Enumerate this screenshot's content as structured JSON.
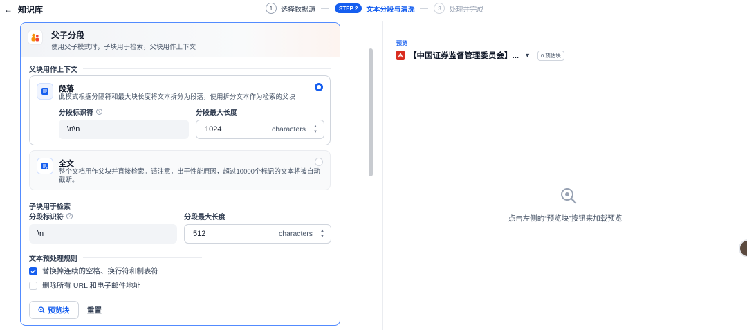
{
  "topbar": {
    "back_label": "知识库",
    "steps": [
      {
        "num": "1",
        "label": "选择数据源"
      },
      {
        "badge": "STEP 2",
        "label": "文本分段与清洗"
      },
      {
        "num": "3",
        "label": "处理并完成"
      }
    ]
  },
  "parent_child": {
    "title": "父子分段",
    "desc": "使用父子模式时，子块用于检索，父块用作上下文",
    "parent_section": "父块用作上下文",
    "paragraph": {
      "title": "段落",
      "desc": "此模式根据分隔符和最大块长度将文本拆分为段落，使用拆分文本作为检索的父块",
      "delimiter_label": "分段标识符",
      "delimiter_value": "\\n\\n",
      "maxlen_label": "分段最大长度",
      "maxlen_value": "1024",
      "unit": "characters"
    },
    "fulltext": {
      "title": "全文",
      "desc": "整个文档用作父块并直接检索。请注意，出于性能原因，超过10000个标记的文本将被自动截断。"
    },
    "child_section": "子块用于检索",
    "child": {
      "delimiter_label": "分段标识符",
      "delimiter_value": "\\n",
      "maxlen_label": "分段最大长度",
      "maxlen_value": "512",
      "unit": "characters"
    },
    "rules_section": "文本预处理规则",
    "rules": [
      {
        "label": "替换掉连续的空格、换行符和制表符",
        "checked": true
      },
      {
        "label": "删除所有 URL 和电子邮件地址",
        "checked": false
      }
    ],
    "preview_button": "预览块",
    "reset_button": "重置"
  },
  "preview_panel": {
    "label": "预览",
    "doc_name": "【中国证券监督管理委员会】...",
    "estimate_badge": "0 预估块",
    "empty_text": "点击左侧的“预览块”按钮来加载预览"
  },
  "colors": {
    "accent": "#155eef",
    "selected_border": "#528bff",
    "pdf_red": "#d92d20"
  }
}
